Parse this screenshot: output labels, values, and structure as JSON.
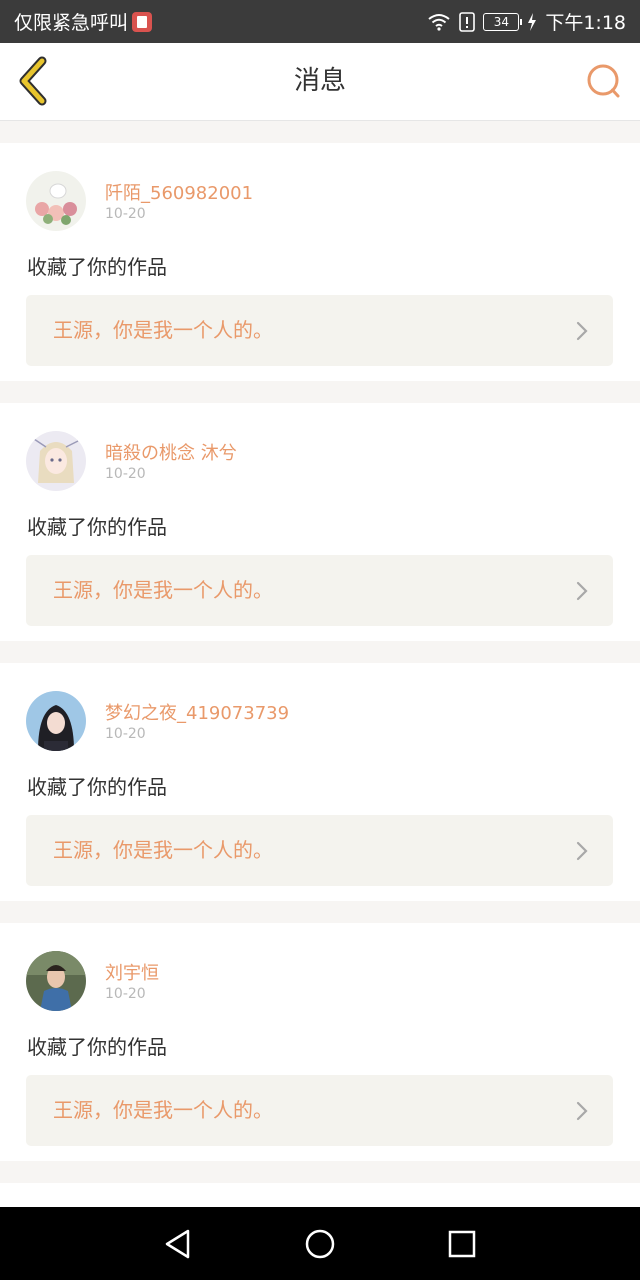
{
  "status_bar": {
    "carrier_text": "仅限紧急呼叫",
    "battery_level": "34",
    "time": "下午1:18"
  },
  "header": {
    "title": "消息",
    "back_icon": "chevron-left-icon",
    "search_icon": "search-icon"
  },
  "colors": {
    "accent": "#e9996a",
    "back_icon": "#c7a628",
    "text": "#333333",
    "muted": "#b8b8b8",
    "card_link_bg": "#f4f3ee"
  },
  "messages": [
    {
      "username": "阡陌_560982001",
      "date": "10-20",
      "action": "收藏了你的作品",
      "work_title": "王源，你是我一个人的。"
    },
    {
      "username": "暗殺の桃念 沐兮",
      "date": "10-20",
      "action": "收藏了你的作品",
      "work_title": "王源，你是我一个人的。"
    },
    {
      "username": "梦幻之夜_419073739",
      "date": "10-20",
      "action": "收藏了你的作品",
      "work_title": "王源，你是我一个人的。"
    },
    {
      "username": "刘宇恒",
      "date": "10-20",
      "action": "收藏了你的作品",
      "work_title": "王源，你是我一个人的。"
    }
  ],
  "nav_bar": {
    "back": "triangle-back-icon",
    "home": "circle-home-icon",
    "recents": "square-recents-icon"
  }
}
